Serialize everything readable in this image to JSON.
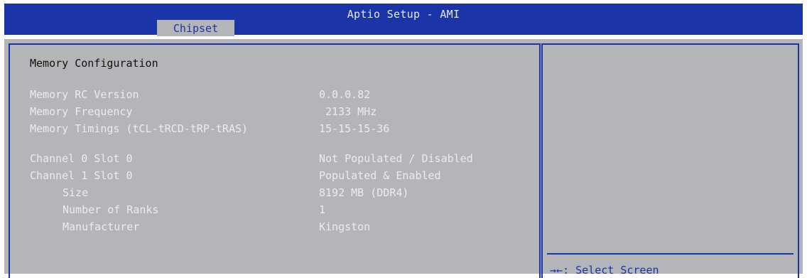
{
  "header": {
    "title": "Aptio Setup - AMI",
    "tabs": [
      {
        "label": "Chipset"
      }
    ]
  },
  "main": {
    "section_title": "Memory Configuration",
    "items": [
      {
        "label": "Memory RC Version",
        "value": "0.0.0.82"
      },
      {
        "label": "Memory Frequency",
        "value": "2133 MHz"
      },
      {
        "label": "Memory Timings (tCL-tRCD-tRP-tRAS)",
        "value": "15-15-15-36"
      },
      {
        "label": "Channel 0 Slot 0",
        "value": "Not Populated / Disabled"
      },
      {
        "label": "Channel 1 Slot 0",
        "value": "Populated & Enabled"
      },
      {
        "label": "Size",
        "value": "8192 MB (DDR4)"
      },
      {
        "label": "Number of Ranks",
        "value": "1"
      },
      {
        "label": "Manufacturer",
        "value": "Kingston"
      }
    ]
  },
  "help": {
    "lines": [
      {
        "key": "→←",
        "text": ": Select Screen"
      }
    ]
  },
  "colors": {
    "header_bg": "#1b35a8",
    "panel_bg": "#b4b5b8",
    "border": "#1b35a8",
    "dim_text": "#ebecee",
    "heading_text": "#111111",
    "help_text": "#1b35a8"
  }
}
